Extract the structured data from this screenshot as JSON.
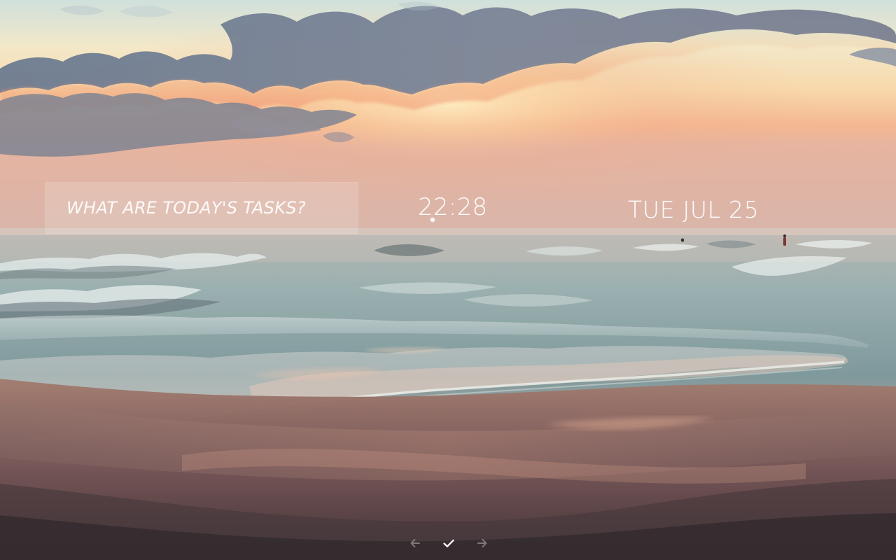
{
  "task_prompt": {
    "placeholder": "What are today's tasks?"
  },
  "clock": {
    "time": "22:28"
  },
  "date": {
    "text": "Tue Jul 25"
  },
  "navigation": {
    "previous_icon": "arrow-left-icon",
    "confirm_icon": "check-icon",
    "next_icon": "arrow-right-icon"
  },
  "colors": {
    "text": "#ffffff",
    "panel": "#ffffff",
    "sky_top": "#e7e0c6",
    "sunset_orange": "#f4a57a",
    "cloud_blue": "#6f7f95",
    "sea": "#8fa4a8",
    "sand": "#5b4547"
  }
}
